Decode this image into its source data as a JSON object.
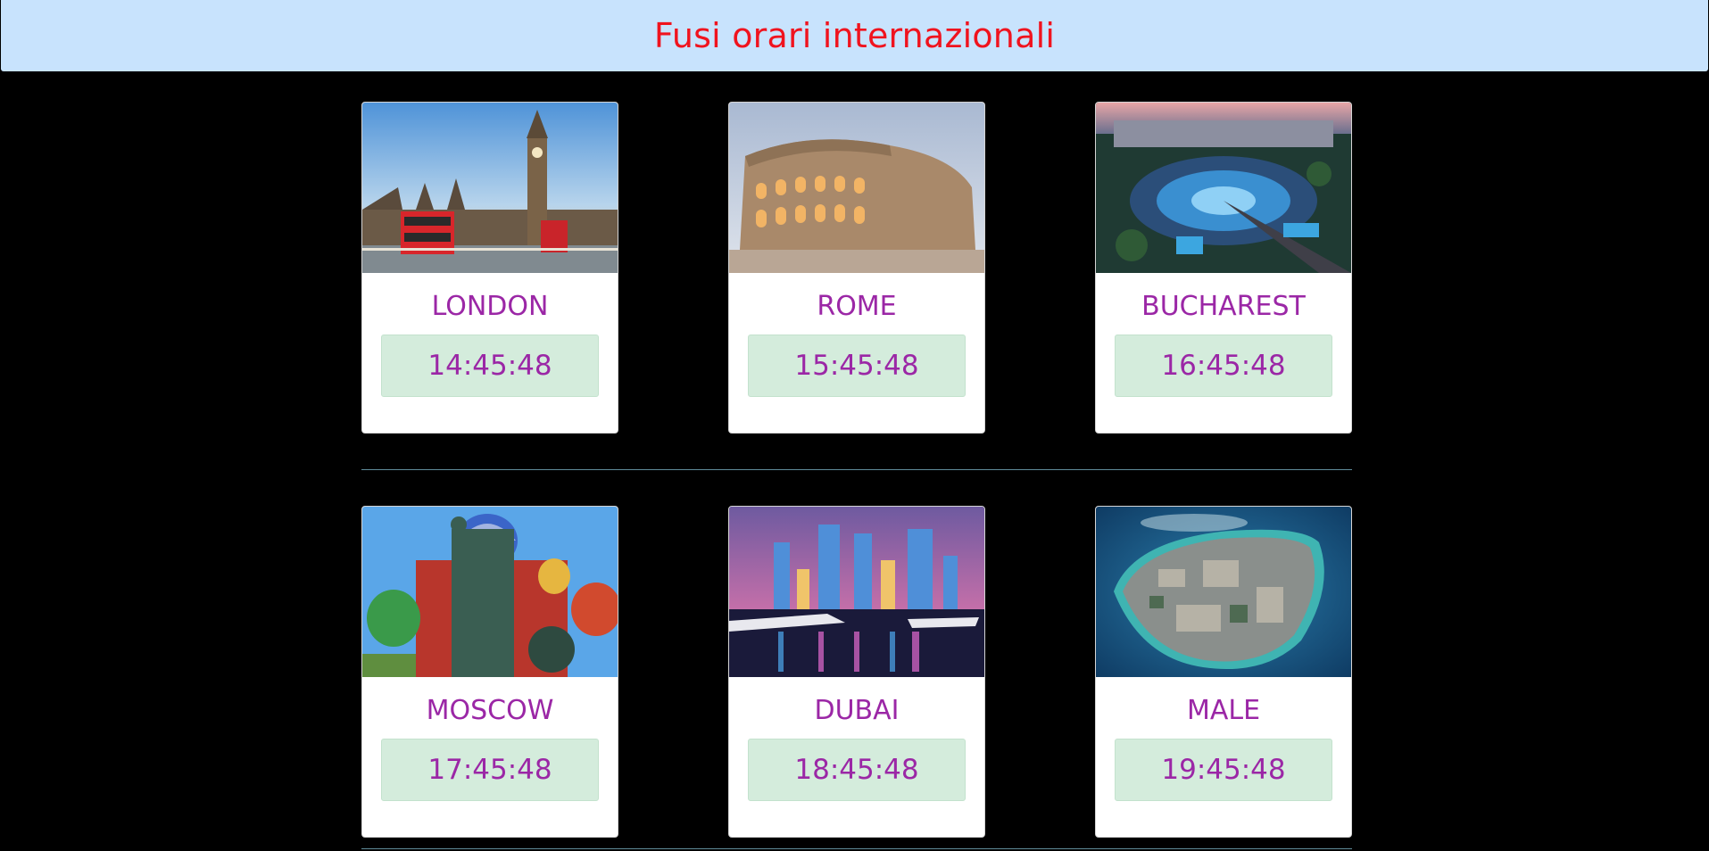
{
  "header": {
    "title": "Fusi orari internazionali"
  },
  "colors": {
    "background": "#000000",
    "header_bg": "#c8e3fd",
    "title": "#f0131e",
    "city_text": "#9b27a6",
    "time_bg": "#d4ecdc"
  },
  "cities": [
    {
      "name": "LONDON",
      "time": "14:45:48",
      "photo": "big-ben-photo"
    },
    {
      "name": "ROME",
      "time": "15:45:48",
      "photo": "colosseum-photo"
    },
    {
      "name": "BUCHAREST",
      "time": "16:45:48",
      "photo": "bucharest-square-photo"
    },
    {
      "name": "MOSCOW",
      "time": "17:45:48",
      "photo": "st-basils-cathedral-photo"
    },
    {
      "name": "DUBAI",
      "time": "18:45:48",
      "photo": "dubai-marina-photo"
    },
    {
      "name": "MALE",
      "time": "19:45:48",
      "photo": "male-island-photo"
    }
  ]
}
